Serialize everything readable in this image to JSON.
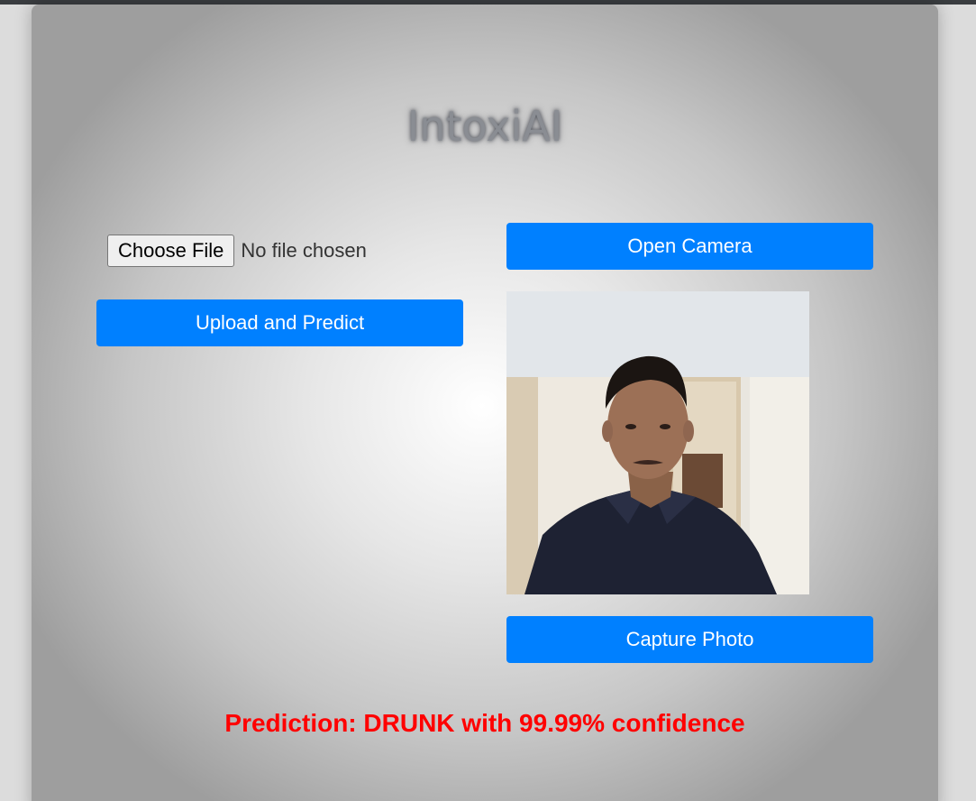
{
  "app": {
    "title": "IntoxiAI"
  },
  "upload": {
    "choose_file_label": "Choose File",
    "file_status": "No file chosen",
    "upload_button_label": "Upload and Predict"
  },
  "camera": {
    "open_button_label": "Open Camera",
    "capture_button_label": "Capture Photo"
  },
  "result": {
    "prediction_text": "Prediction: DRUNK with 99.99% confidence"
  },
  "colors": {
    "button_blue": "#0080ff",
    "prediction_red": "#ff0000"
  }
}
